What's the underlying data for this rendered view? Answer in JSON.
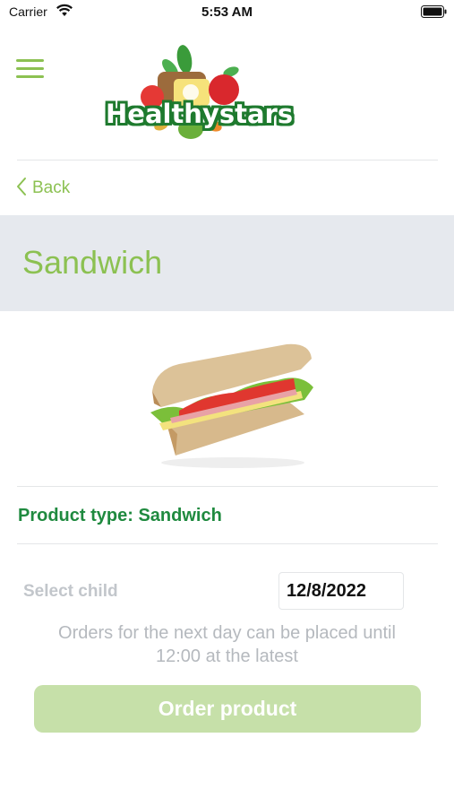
{
  "status_bar": {
    "carrier": "Carrier",
    "time": "5:53 AM",
    "wifi_icon": "wifi-icon",
    "battery_icon": "battery-icon"
  },
  "header": {
    "menu_icon": "hamburger-menu-icon",
    "logo_text": "Healthystars"
  },
  "nav": {
    "back_label": "Back",
    "back_icon": "chevron-left-icon"
  },
  "page": {
    "title": "Sandwich"
  },
  "product": {
    "image_icon": "sandwich-image",
    "type_label": "Product type: Sandwich"
  },
  "order_form": {
    "select_child_label": "Select child",
    "date_value": "12/8/2022",
    "notice": "Orders for the next day can be placed until 12:00 at the latest",
    "order_button_label": "Order product"
  },
  "colors": {
    "accent_green": "#8cc152",
    "dark_green": "#1f8a3f",
    "button_disabled": "#c6e0a9",
    "title_band": "#e6e9ee"
  }
}
